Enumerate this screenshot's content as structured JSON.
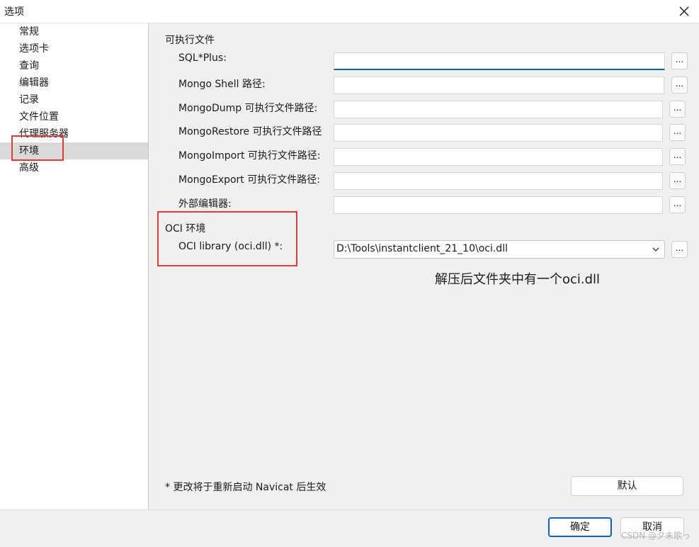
{
  "window": {
    "title": "选项"
  },
  "sidebar": {
    "items": [
      {
        "label": "常规"
      },
      {
        "label": "选项卡"
      },
      {
        "label": "查询"
      },
      {
        "label": "编辑器"
      },
      {
        "label": "记录"
      },
      {
        "label": "文件位置"
      },
      {
        "label": "代理服务器"
      },
      {
        "label": "环境",
        "selected": true
      },
      {
        "label": "高级"
      }
    ]
  },
  "executables": {
    "section_title": "可执行文件",
    "rows": [
      {
        "label": "SQL*Plus:",
        "value": ""
      },
      {
        "label": "Mongo Shell 路径:",
        "value": ""
      },
      {
        "label": "MongoDump 可执行文件路径:",
        "value": ""
      },
      {
        "label": "MongoRestore 可执行文件路径",
        "value": ""
      },
      {
        "label": "MongoImport 可执行文件路径:",
        "value": ""
      },
      {
        "label": "MongoExport 可执行文件路径:",
        "value": ""
      },
      {
        "label": "外部编辑器:",
        "value": ""
      }
    ],
    "browse_label": "..."
  },
  "oci": {
    "section_title": "OCI 环境",
    "label": "OCI library (oci.dll) *:",
    "value": "D:\\Tools\\instantclient_21_10\\oci.dll"
  },
  "annotation": "解压后文件夹中有一个oci.dll",
  "footnote": "* 更改将于重新启动 Navicat 后生效",
  "buttons": {
    "default": "默认",
    "ok": "确定",
    "cancel": "取消"
  },
  "watermark": "CSDN @夕未歌っ",
  "colors": {
    "highlight_box": "#e53935",
    "focus_accent": "#0067c0",
    "selected_item": "#d9d9d9"
  }
}
